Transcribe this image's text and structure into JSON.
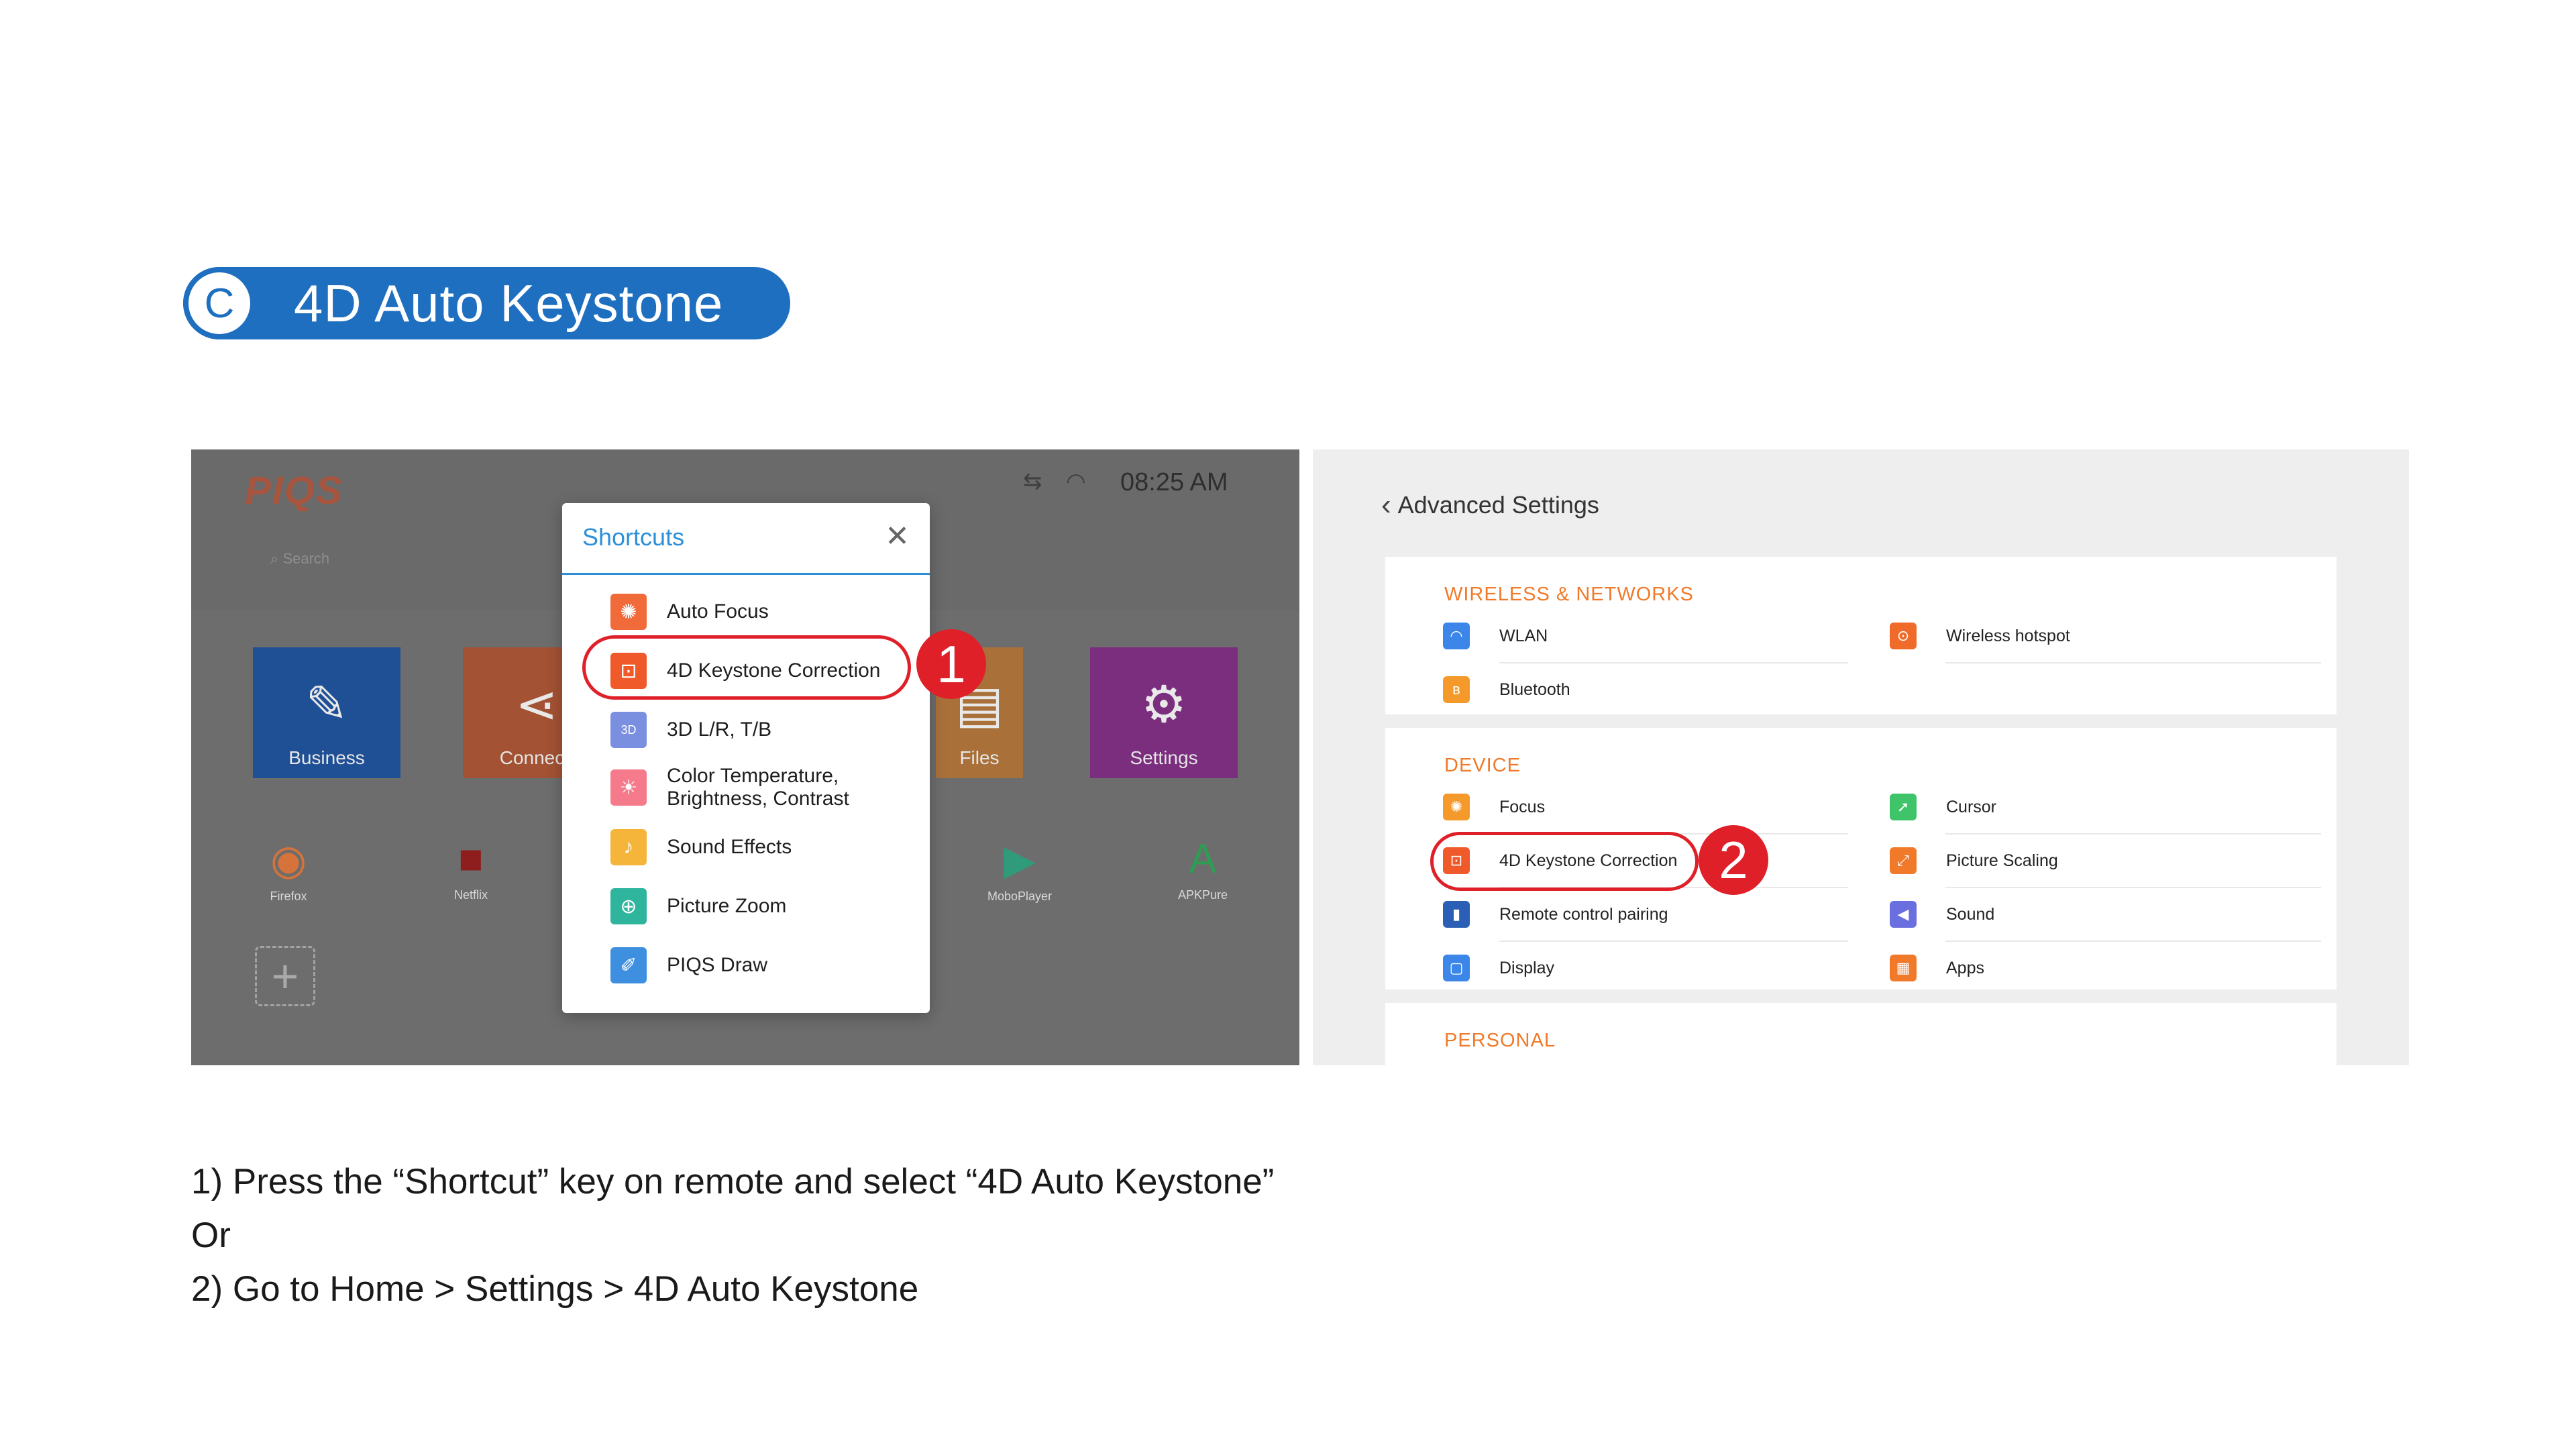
{
  "section": {
    "letter": "C",
    "title": "4D Auto Keystone"
  },
  "home_screen": {
    "logo": "PIQS",
    "search_hint": "Search",
    "time": "08:25 AM",
    "tiles": [
      {
        "label": "Business",
        "color": "#1f4f95",
        "icon": "business-icon"
      },
      {
        "label": "Connecti",
        "color": "#a35233",
        "icon": "share-icon"
      },
      {
        "label": "Files",
        "color": "#a9703a",
        "icon": "files-icon"
      },
      {
        "label": "Settings",
        "color": "#7b2d7e",
        "icon": "gear-icon"
      }
    ],
    "apps": [
      {
        "label": "Firefox",
        "icon": "firefox-icon"
      },
      {
        "label": "Netflix",
        "icon": "netflix-icon"
      },
      {
        "label": "MoboPlayer",
        "icon": "play-icon"
      },
      {
        "label": "APKPure",
        "icon": "apkpure-icon"
      }
    ],
    "add_label": "+"
  },
  "shortcuts": {
    "title": "Shortcuts",
    "close": "✕",
    "items": [
      {
        "label": "Auto Focus",
        "icon": "auto-focus-icon",
        "color": "#f06a3a"
      },
      {
        "label": "4D Keystone Correction",
        "icon": "keystone-icon",
        "color": "#f05a2a"
      },
      {
        "label": "3D L/R, T/B",
        "icon": "3d-icon",
        "color": "#7b8fe0"
      },
      {
        "label": "Color Temperature,\nBrightness, Contrast",
        "label_1": "Color Temperature,",
        "label_2": "Brightness, Contrast",
        "icon": "brightness-icon",
        "color": "#f47a8c"
      },
      {
        "label": "Sound Effects",
        "icon": "sound-effects-icon",
        "color": "#f5b53a"
      },
      {
        "label": "Picture Zoom",
        "icon": "zoom-icon",
        "color": "#2fb59e"
      },
      {
        "label": "PIQS Draw",
        "icon": "draw-icon",
        "color": "#3f8fe0"
      }
    ]
  },
  "steps": {
    "one": "1",
    "two": "2"
  },
  "advanced": {
    "title": "Advanced Settings",
    "wireless": {
      "title": "WIRELESS & NETWORKS",
      "items": [
        {
          "label": "WLAN",
          "icon": "wifi-icon",
          "color": "#3b86e8"
        },
        {
          "label": "Wireless hotspot",
          "icon": "hotspot-icon",
          "color": "#f06a2a"
        },
        {
          "label": "Bluetooth",
          "icon": "bluetooth-icon",
          "color": "#f59a2a"
        }
      ]
    },
    "device": {
      "title": "DEVICE",
      "items": [
        {
          "label": "Focus",
          "icon": "focus-icon",
          "color": "#f59a2a"
        },
        {
          "label": "Cursor",
          "icon": "cursor-icon",
          "color": "#3fc46a"
        },
        {
          "label": "4D Keystone Correction",
          "icon": "keystone-icon",
          "color": "#f05a2a"
        },
        {
          "label": "Picture Scaling",
          "icon": "scaling-icon",
          "color": "#f07a2a"
        },
        {
          "label": "Remote control pairing",
          "icon": "remote-icon",
          "color": "#2a5fb5"
        },
        {
          "label": "Sound",
          "icon": "sound-icon",
          "color": "#6a6fe0"
        },
        {
          "label": "Display",
          "icon": "display-icon",
          "color": "#3b86e8"
        },
        {
          "label": "Apps",
          "icon": "apps-icon",
          "color": "#f07a2a"
        }
      ]
    },
    "personal": {
      "title": "PERSONAL"
    }
  },
  "instructions": {
    "line1": "1) Press the “Shortcut” key on remote and select “4D Auto Keystone”",
    "line2": "Or",
    "line3": "2) Go to Home > Settings > 4D Auto Keystone"
  }
}
